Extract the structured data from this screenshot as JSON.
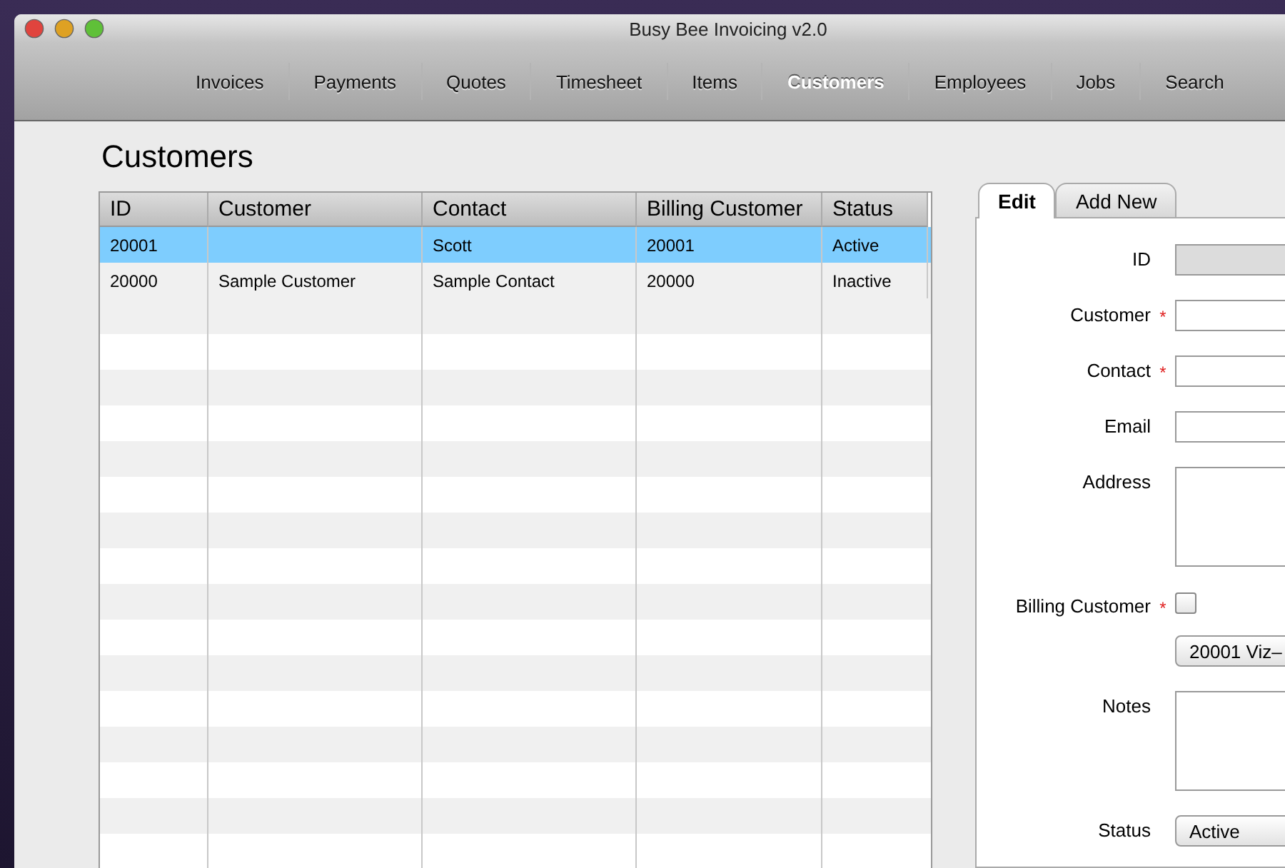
{
  "window": {
    "title": "Busy Bee Invoicing v2.0"
  },
  "toolbar": [
    {
      "label": "Invoices",
      "selected": false
    },
    {
      "label": "Payments",
      "selected": false
    },
    {
      "label": "Quotes",
      "selected": false
    },
    {
      "label": "Timesheet",
      "selected": false
    },
    {
      "label": "Items",
      "selected": false
    },
    {
      "label": "Customers",
      "selected": true
    },
    {
      "label": "Employees",
      "selected": false
    },
    {
      "label": "Jobs",
      "selected": false
    },
    {
      "label": "Search",
      "selected": false
    }
  ],
  "page_title": "Customers",
  "table": {
    "columns": [
      "ID",
      "Customer",
      "Contact",
      "Billing Customer",
      "Status"
    ],
    "rows": [
      {
        "cells": [
          "20001",
          "",
          "Scott",
          "20001",
          "Active"
        ],
        "selected": true
      },
      {
        "cells": [
          "20000",
          "Sample Customer",
          "Sample Contact",
          "20000",
          "Inactive"
        ],
        "selected": false
      }
    ]
  },
  "tabs": [
    {
      "label": "Edit",
      "selected": true
    },
    {
      "label": "Add New",
      "selected": false
    }
  ],
  "form": [
    {
      "kind": "input",
      "label": "ID",
      "disabled": true
    },
    {
      "kind": "input",
      "label": "Customer",
      "required_mark": "*",
      "disabled": false
    },
    {
      "kind": "input",
      "label": "Contact",
      "required_mark": "*",
      "disabled": false
    },
    {
      "kind": "input",
      "label": "Email",
      "disabled": false
    },
    {
      "kind": "textarea",
      "label": "Address"
    },
    {
      "kind": "checkbox",
      "label": "Billing Customer",
      "required_mark": "*",
      "checked": false
    },
    {
      "kind": "select",
      "value": "20001 Viz–"
    },
    {
      "kind": "textarea",
      "label": "Notes"
    },
    {
      "kind": "popup",
      "label": "Status",
      "value": "Active"
    }
  ]
}
